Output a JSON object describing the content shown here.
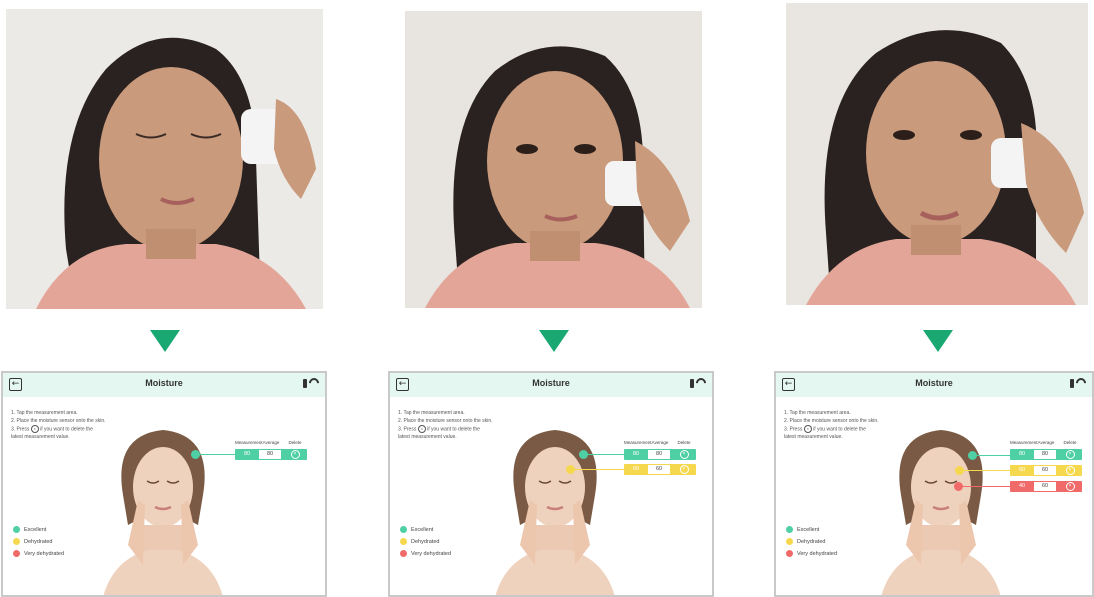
{
  "screens": [
    {
      "header": {
        "title": "Moisture"
      },
      "instructions": [
        "1. Tap the measurement area.",
        "2. Place the moisture sensor onto the skin.",
        "3. Press",
        "if you want to delete the",
        "latest measurement value."
      ],
      "table": {
        "headers": [
          "Measurement",
          "Average",
          "Delete"
        ],
        "rows": [
          {
            "measurement": "80",
            "average": "80",
            "status": "excellent"
          }
        ]
      },
      "legend": [
        {
          "label": "Excellent",
          "color": "#4ecfa4"
        },
        {
          "label": "Dehydrated",
          "color": "#f6d84f"
        },
        {
          "label": "Very dehydrated",
          "color": "#f06a6a"
        }
      ]
    },
    {
      "header": {
        "title": "Moisture"
      },
      "instructions": [
        "1. Tap the measurement area.",
        "2. Place the moisture sensor onto the skin.",
        "3. Press",
        "if you want to delete the",
        "latest measurement value."
      ],
      "table": {
        "headers": [
          "Measurement",
          "Average",
          "Delete"
        ],
        "rows": [
          {
            "measurement": "80",
            "average": "80",
            "status": "excellent"
          },
          {
            "measurement": "60",
            "average": "60",
            "status": "dehydrated"
          }
        ]
      },
      "legend": [
        {
          "label": "Excellent",
          "color": "#4ecfa4"
        },
        {
          "label": "Dehydrated",
          "color": "#f6d84f"
        },
        {
          "label": "Very dehydrated",
          "color": "#f06a6a"
        }
      ]
    },
    {
      "header": {
        "title": "Moisture"
      },
      "instructions": [
        "1. Tap the measurement area.",
        "2. Place the moisture sensor onto the skin.",
        "3. Press",
        "if you want to delete the",
        "latest measurement value."
      ],
      "table": {
        "headers": [
          "Measurement",
          "Average",
          "Delete"
        ],
        "rows": [
          {
            "measurement": "80",
            "average": "80",
            "status": "excellent"
          },
          {
            "measurement": "60",
            "average": "60",
            "status": "dehydrated"
          },
          {
            "measurement": "40",
            "average": "60",
            "status": "very_dehydrated"
          }
        ]
      },
      "legend": [
        {
          "label": "Excellent",
          "color": "#4ecfa4"
        },
        {
          "label": "Dehydrated",
          "color": "#f6d84f"
        },
        {
          "label": "Very dehydrated",
          "color": "#f06a6a"
        }
      ]
    }
  ],
  "icons": {
    "back": "back-arrow-icon",
    "battery": "battery-icon",
    "connection": "bluetooth-signal-icon",
    "delete": "delete-x-icon",
    "arrow": "down-arrow-icon"
  },
  "colors": {
    "accent": "#1aa872",
    "header_bg": "#e4f8f1",
    "excellent": "#4ecfa4",
    "dehydrated": "#f6d84f",
    "very_dehydrated": "#f06a6a"
  }
}
